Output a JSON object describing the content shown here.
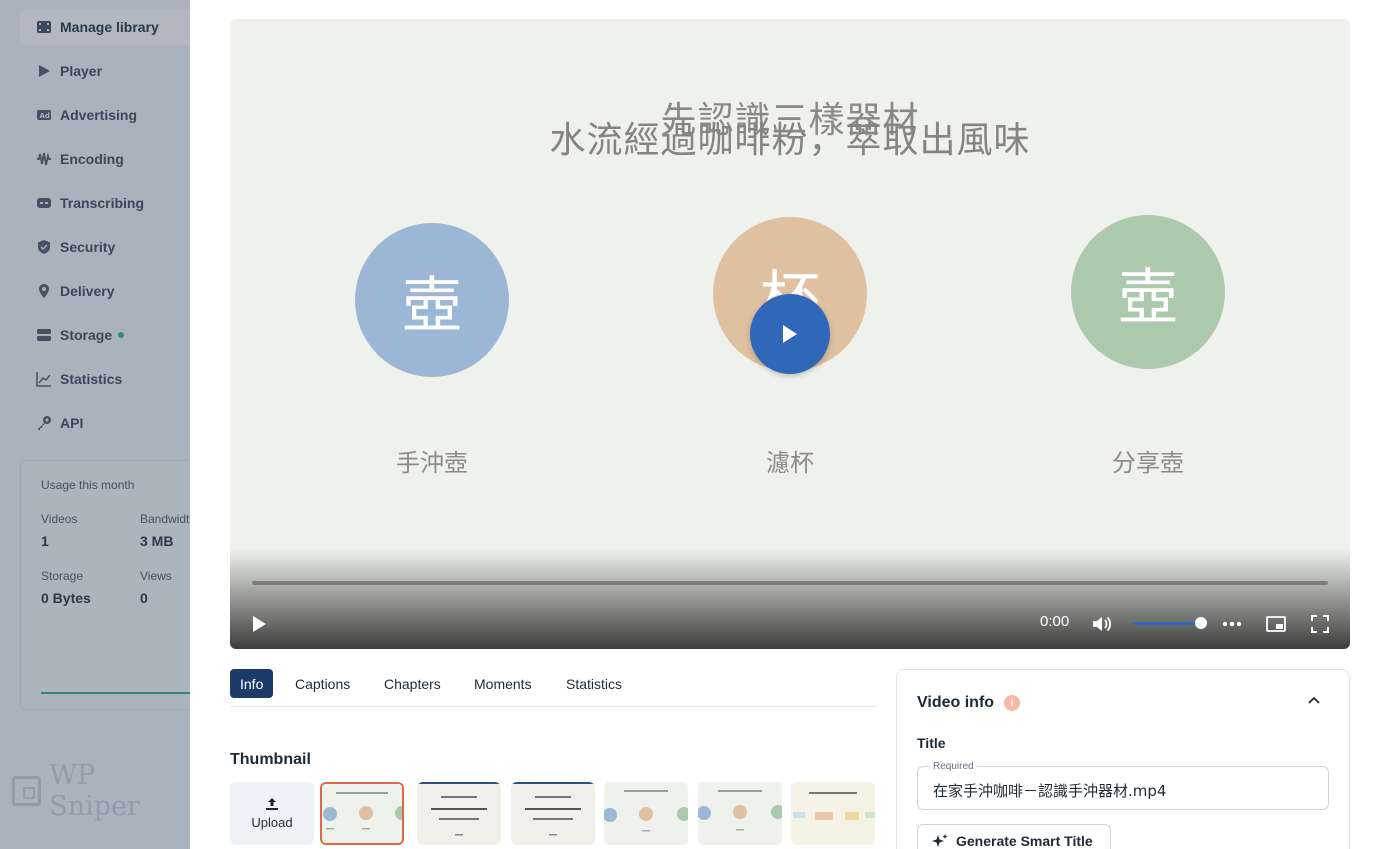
{
  "sidebar": {
    "items": [
      {
        "label": "Manage library",
        "icon": "film-icon",
        "active": true
      },
      {
        "label": "Player",
        "icon": "play-icon"
      },
      {
        "label": "Advertising",
        "icon": "ad-icon"
      },
      {
        "label": "Encoding",
        "icon": "waveform-icon"
      },
      {
        "label": "Transcribing",
        "icon": "caption-icon"
      },
      {
        "label": "Security",
        "icon": "shield-icon"
      },
      {
        "label": "Delivery",
        "icon": "location-pin-icon"
      },
      {
        "label": "Storage",
        "icon": "storage-icon",
        "status_dot": true
      },
      {
        "label": "Statistics",
        "icon": "chart-line-icon"
      },
      {
        "label": "API",
        "icon": "key-icon"
      }
    ],
    "usage": {
      "title": "Usage this month",
      "videos_label": "Videos",
      "videos_value": "1",
      "bandwidth_label": "Bandwidth",
      "bandwidth_value": "3 MB",
      "storage_label": "Storage",
      "storage_value": "0 Bytes",
      "views_label": "Views",
      "views_value": "0"
    },
    "logo_text": "WP Sniper",
    "status_dot_color": "#2fb58a"
  },
  "video": {
    "caption_top": "先認識三樣器材",
    "caption_overlay": "水流經過咖啡粉，萃取出風味",
    "items": [
      {
        "glyph": "壺",
        "label": "手沖壺",
        "color": "#9cb7d5"
      },
      {
        "glyph": "杯",
        "label": "濾杯",
        "color": "#dfc0a0"
      },
      {
        "glyph": "壺",
        "label": "分享壺",
        "color": "#acc9ae"
      }
    ],
    "time": "0:00",
    "volume_level": 0.9,
    "progress": 0
  },
  "tabs": [
    {
      "label": "Info",
      "active": true
    },
    {
      "label": "Captions"
    },
    {
      "label": "Chapters"
    },
    {
      "label": "Moments"
    },
    {
      "label": "Statistics"
    }
  ],
  "thumbnail": {
    "heading": "Thumbnail",
    "upload_label": "Upload"
  },
  "video_info": {
    "heading": "Video info",
    "badge": "i",
    "title_label": "Title",
    "required_label": "Required",
    "title_value": "在家手沖咖啡－認識手沖器材.mp4",
    "smart_title_button": "Generate Smart Title"
  },
  "colors": {
    "accent": "#2f68b8",
    "tab_active": "#1d3a6b",
    "thumb_selected": "#e0674a"
  }
}
